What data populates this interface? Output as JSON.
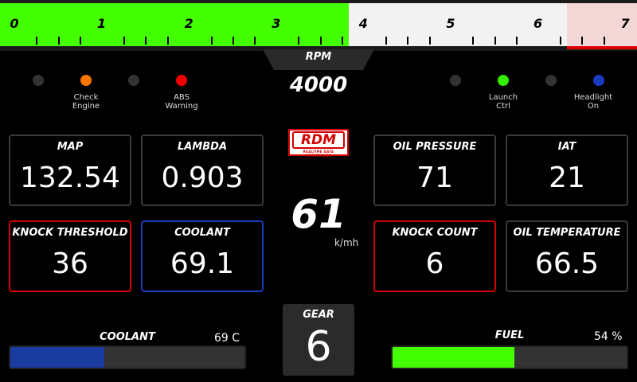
{
  "rpm": {
    "label": "RPM",
    "value": "4000",
    "current": 4000,
    "max": 7300,
    "redline": 6500,
    "ticks": [
      "0",
      "1",
      "2",
      "3",
      "4",
      "5",
      "6",
      "7"
    ],
    "fill_color": "#44ff00",
    "redline_color": "#e00000"
  },
  "indicators": {
    "left": [
      {
        "label": "",
        "color": "#333333"
      },
      {
        "label": "Check\nEngine",
        "color": "#ff7700"
      },
      {
        "label": "",
        "color": "#333333"
      },
      {
        "label": "ABS\nWarning",
        "color": "#ee0000"
      }
    ],
    "right": [
      {
        "label": "",
        "color": "#333333"
      },
      {
        "label": "Launch\nCtrl",
        "color": "#33ee00"
      },
      {
        "label": "",
        "color": "#333333"
      },
      {
        "label": "Headlight\nOn",
        "color": "#1a3cc0"
      }
    ]
  },
  "boxes": {
    "map": {
      "title": "MAP",
      "value": "132.54",
      "border": "#3a3a3a"
    },
    "lambda": {
      "title": "LAMBDA",
      "value": "0.903",
      "border": "#3a3a3a"
    },
    "knock_threshold": {
      "title": "KNOCK THRESHOLD",
      "value": "36",
      "border": "#d40000"
    },
    "coolant": {
      "title": "COOLANT",
      "value": "69.1",
      "border": "#1a3cc0"
    },
    "oil_pressure": {
      "title": "OIL PRESSURE",
      "value": "71",
      "border": "#3a3a3a"
    },
    "iat": {
      "title": "IAT",
      "value": "21",
      "border": "#3a3a3a"
    },
    "knock_count": {
      "title": "KNOCK COUNT",
      "value": "6",
      "border": "#d40000"
    },
    "oil_temperature": {
      "title": "OIL TEMPERATURE",
      "value": "66.5",
      "border": "#3a3a3a"
    }
  },
  "logo": {
    "text": "RDM",
    "subtitle": "REALTIME DATA MONITORING"
  },
  "speed": {
    "value": "61",
    "unit": "k/mh"
  },
  "gear": {
    "label": "GEAR",
    "value": "6"
  },
  "bars": {
    "coolant": {
      "title": "COOLANT",
      "reading": "69 C",
      "fraction": 0.4,
      "color": "#1a3ca0"
    },
    "fuel": {
      "title": "FUEL",
      "reading": "54 %",
      "fraction": 0.52,
      "color": "#44ff00"
    }
  }
}
